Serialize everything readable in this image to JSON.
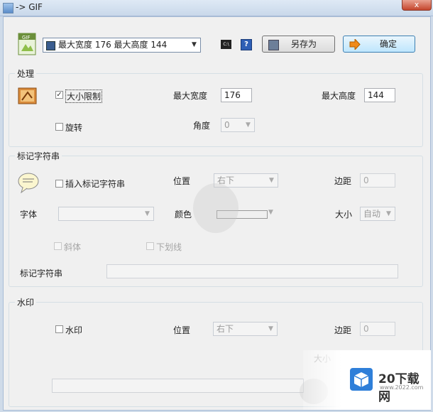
{
  "window": {
    "title": "-> GIF",
    "close": "x"
  },
  "top": {
    "preset_value": "最大宽度 176 最大高度 144",
    "saveas_label": "另存为",
    "ok_label": "确定",
    "help_glyph": "?",
    "cmd_glyph": "C:\\"
  },
  "process": {
    "title": "处理",
    "size_limit_label": "大小限制",
    "size_limit_checked": true,
    "max_width_label": "最大宽度",
    "max_width_value": "176",
    "max_height_label": "最大高度",
    "max_height_value": "144",
    "rotate_label": "旋转",
    "angle_label": "角度",
    "angle_value": "0"
  },
  "marker": {
    "title": "标记字符串",
    "insert_label": "插入标记字符串",
    "position_label": "位置",
    "position_value": "右下",
    "margin_label": "边距",
    "margin_value": "0",
    "font_label": "字体",
    "color_label": "颜色",
    "size_label": "大小",
    "size_value": "自动",
    "italic_label": "斜体",
    "underline_label": "下划线",
    "string_label": "标记字符串"
  },
  "watermark": {
    "title": "水印",
    "wm_label": "水印",
    "position_label": "位置",
    "position_value": "右下",
    "margin_label": "边距",
    "margin_value": "0",
    "size_label": "大小"
  },
  "brand": {
    "text": "20下载网",
    "url": "www.2022.com"
  }
}
